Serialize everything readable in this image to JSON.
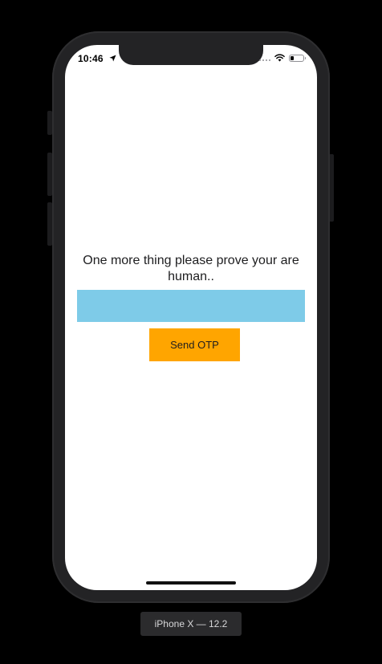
{
  "status_bar": {
    "time": "10:46",
    "location_icon": "location-arrow-icon",
    "wifi_icon": "wifi-icon",
    "battery_icon": "battery-icon",
    "battery_level": 0.25
  },
  "main": {
    "prompt_text": "One more thing please prove your are human..",
    "otp_input": {
      "value": "",
      "placeholder": ""
    },
    "send_button_label": "Send OTP"
  },
  "simulator": {
    "device_label": "iPhone X — 12.2"
  },
  "colors": {
    "input_background": "#7ecbe8",
    "button_background": "#ffa500",
    "screen_background": "#ffffff",
    "device_frame": "#232325"
  }
}
